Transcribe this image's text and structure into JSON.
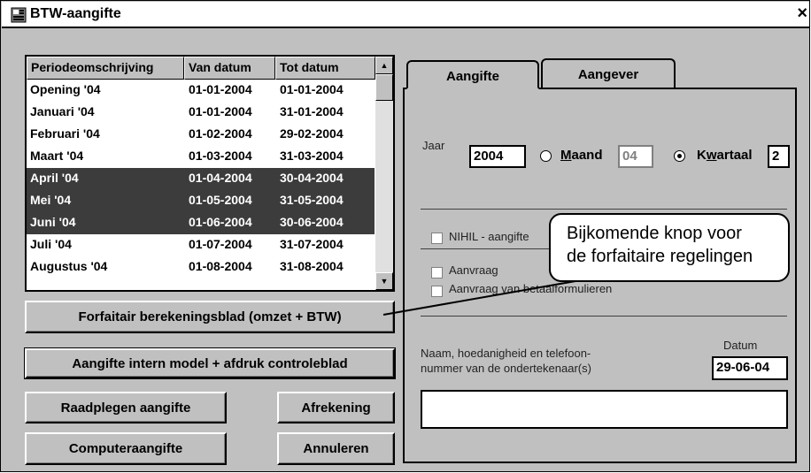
{
  "window": {
    "title": "BTW-aangifte",
    "close_symbol": "×",
    "icon": "app-icon"
  },
  "list": {
    "headers": [
      "Periodeomschrijving",
      "Van datum",
      "Tot datum"
    ],
    "rows": [
      {
        "name": "Opening '04",
        "from": "01-01-2004",
        "to": "01-01-2004",
        "selected": false
      },
      {
        "name": "Januari '04",
        "from": "01-01-2004",
        "to": "31-01-2004",
        "selected": false
      },
      {
        "name": "Februari '04",
        "from": "01-02-2004",
        "to": "29-02-2004",
        "selected": false
      },
      {
        "name": "Maart '04",
        "from": "01-03-2004",
        "to": "31-03-2004",
        "selected": false
      },
      {
        "name": "April '04",
        "from": "01-04-2004",
        "to": "30-04-2004",
        "selected": true
      },
      {
        "name": "Mei '04",
        "from": "01-05-2004",
        "to": "31-05-2004",
        "selected": true
      },
      {
        "name": "Juni '04",
        "from": "01-06-2004",
        "to": "30-06-2004",
        "selected": true
      },
      {
        "name": "Juli '04",
        "from": "01-07-2004",
        "to": "31-07-2004",
        "selected": false
      },
      {
        "name": "Augustus '04",
        "from": "01-08-2004",
        "to": "31-08-2004",
        "selected": false
      }
    ]
  },
  "buttons": {
    "forfaitair": "Forfaitair berekeningsblad (omzet + BTW)",
    "aangifte_intern": "Aangifte intern model + afdruk controleblad",
    "raadplegen": "Raadplegen aangifte",
    "afrekening": "Afrekening",
    "computeraangifte": "Computeraangifte",
    "annuleren": "Annuleren"
  },
  "tabs": [
    "Aangifte",
    "Aangever"
  ],
  "form": {
    "jaar_label": "Jaar",
    "jaar_value": "2004",
    "maand_label": "Maand",
    "maand_value": "04",
    "kwartaal_label": "Kwartaal",
    "kwartaal_value": "2",
    "selected_period": "Kwartaal",
    "nihil_label": "NIHIL - aangifte",
    "aanvraag1_label": "Aanvraag",
    "aanvraag2_label": "Aanvraag van betaalformulieren",
    "naam_label_1": "Naam, hoedanigheid en telefoon-",
    "naam_label_2": "nummer van de ondertekenaar(s)",
    "datum_label": "Datum",
    "datum_value": "29-06-04",
    "naam_value": ""
  },
  "callout": {
    "line1": "Bijkomende knop voor",
    "line2": "de forfaitaire regelingen"
  }
}
